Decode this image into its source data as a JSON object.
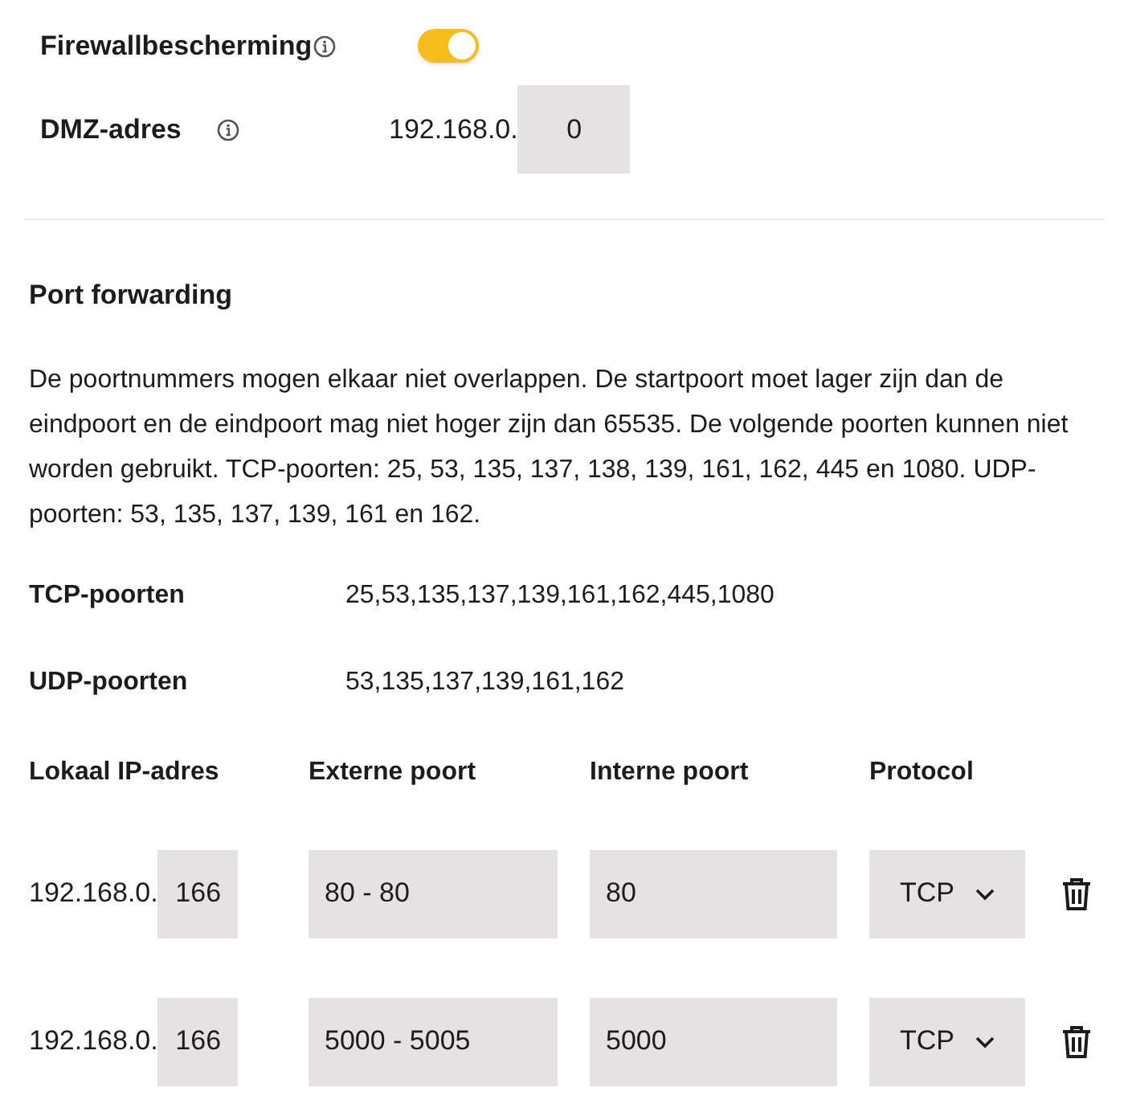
{
  "firewall": {
    "label": "Firewallbescherming",
    "on": true
  },
  "dmz": {
    "label": "DMZ-adres",
    "prefix": "192.168.0.",
    "value": "0"
  },
  "port_forwarding": {
    "title": "Port forwarding",
    "description": "De poortnummers mogen elkaar niet overlappen. De startpoort moet lager zijn dan de eindpoort en de eindpoort mag niet hoger zijn dan 65535. De volgende poorten kunnen niet worden gebruikt. TCP-poorten: 25, 53, 135, 137, 138, 139, 161, 162, 445 en 1080. UDP-poorten: 53, 135, 137, 139, 161 en 162.",
    "blocked": [
      {
        "label": "TCP-poorten",
        "value": "25,53,135,137,139,161,162,445,1080"
      },
      {
        "label": "UDP-poorten",
        "value": "53,135,137,139,161,162"
      }
    ],
    "columns": [
      "Lokaal IP-adres",
      "Externe poort",
      "Interne poort",
      "Protocol"
    ],
    "rules": [
      {
        "ip_prefix": "192.168.0.",
        "ip_suffix": "166",
        "external": "80 - 80",
        "internal": "80",
        "protocol": "TCP"
      },
      {
        "ip_prefix": "192.168.0.",
        "ip_suffix": "166",
        "external": "5000 - 5005",
        "internal": "5000",
        "protocol": "TCP"
      }
    ]
  }
}
